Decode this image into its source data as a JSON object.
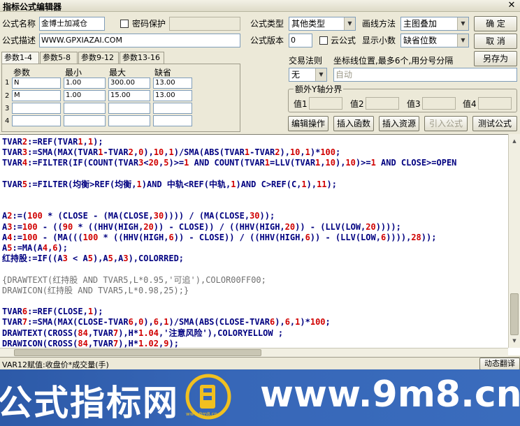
{
  "window": {
    "title": "指标公式编辑器",
    "close_glyph": "✕"
  },
  "form": {
    "name_label": "公式名称",
    "name_value": "金博士加减仓",
    "password_label": "密码保护",
    "password_checked": false,
    "type_label": "公式类型",
    "type_value": "其他类型",
    "draw_label": "画线方法",
    "draw_value": "主图叠加",
    "desc_label": "公式描述",
    "desc_value": "WWW.GPXIAZAI.COM",
    "version_label": "公式版本",
    "version_value": "0",
    "cloud_label": "云公式",
    "cloud_checked": false,
    "decimals_label": "显示小数",
    "decimals_value": "缺省位数",
    "trade_rule_label": "交易法则",
    "trade_rule_value": "无",
    "coord_label": "坐标线位置,最多6个,用分号分隔",
    "coord_placeholder": "自动",
    "extra_axis_label": "额外Y轴分界",
    "value_labels": [
      "值1",
      "值2",
      "值3",
      "值4"
    ]
  },
  "buttons": {
    "confirm": "确  定",
    "cancel": "取  消",
    "save_as": "另存为",
    "edit_ops": "编辑操作",
    "insert_func": "插入函数",
    "insert_resource": "插入资源",
    "import_formula": "引入公式",
    "test_formula": "测试公式",
    "dynamic_translate": "动态翻译"
  },
  "tabs": [
    "参数1-4",
    "参数5-8",
    "参数9-12",
    "参数13-16"
  ],
  "params": {
    "headers": [
      "参数",
      "最小",
      "最大",
      "缺省"
    ],
    "rows": [
      {
        "num": "1",
        "name": "N",
        "min": "1.00",
        "max": "300.00",
        "default": "13.00"
      },
      {
        "num": "2",
        "name": "M",
        "min": "1.00",
        "max": "15.00",
        "default": "13.00"
      },
      {
        "num": "3",
        "name": "",
        "min": "",
        "max": "",
        "default": ""
      },
      {
        "num": "4",
        "name": "",
        "min": "",
        "max": "",
        "default": ""
      }
    ]
  },
  "code": [
    {
      "text": "TVAR2:=REF(TVAR1,1);",
      "style": "normal"
    },
    {
      "text": "TVAR3:=SMA(MAX(TVAR1-TVAR2,0),10,1)/SMA(ABS(TVAR1-TVAR2),10,1)*100;",
      "style": "normal"
    },
    {
      "text": "TVAR4:=FILTER(IF(COUNT(TVAR3<20,5)>=1 AND COUNT(TVAR1=LLV(TVAR1,10),10)>=1 AND CLOSE>=OPEN",
      "style": "normal"
    },
    {
      "text": "",
      "style": "normal"
    },
    {
      "text": "TVAR5:=FILTER(均衡>REF(均衡,1)AND 中轨<REF(中轨,1)AND C>REF(C,1),11);",
      "style": "normal"
    },
    {
      "text": "",
      "style": "normal"
    },
    {
      "text": "",
      "style": "normal"
    },
    {
      "text": "A2:=(100 * (CLOSE - (MA(CLOSE,30)))) / (MA(CLOSE,30));",
      "style": "normal"
    },
    {
      "text": "A3:=100 - ((90 * ((HHV(HIGH,20)) - CLOSE)) / ((HHV(HIGH,20)) - (LLV(LOW,20))));",
      "style": "normal"
    },
    {
      "text": "A4:=100 - (MA(((100 * ((HHV(HIGH,6)) - CLOSE)) / ((HHV(HIGH,6)) - (LLV(LOW,6)))),28));",
      "style": "normal"
    },
    {
      "text": "A5:=MA(A4,6);",
      "style": "normal"
    },
    {
      "text": "红持股:=IF((A3 < A5),A5,A3),COLORRED;",
      "style": "normal"
    },
    {
      "text": "",
      "style": "normal"
    },
    {
      "text": "{DRAWTEXT(红持股 AND TVAR5,L*0.95,'可追'),COLOR00FF00;",
      "style": "comment"
    },
    {
      "text": "DRAWICON(红持股 AND TVAR5,L*0.98,25);}",
      "style": "comment"
    },
    {
      "text": "",
      "style": "normal"
    },
    {
      "text": "TVAR6:=REF(CLOSE,1);",
      "style": "normal"
    },
    {
      "text": "TVAR7:=SMA(MAX(CLOSE-TVAR6,0),6,1)/SMA(ABS(CLOSE-TVAR6),6,1)*100;",
      "style": "normal"
    },
    {
      "text": "DRAWTEXT(CROSS(84,TVAR7),H*1.04,'注意风险'),COLORYELLOW ;",
      "style": "normal"
    },
    {
      "text": "DRAWICON(CROSS(84,TVAR7),H*1.02,9);",
      "style": "normal"
    }
  ],
  "status": {
    "text": "VAR12赋值:收盘价*成交量(手)"
  },
  "banner": {
    "left_text": "公式指标网",
    "right_text": "www.9m8.cn",
    "logo_text": "www.9m8.cn"
  },
  "colors": {
    "keyword": "#000080",
    "number": "#d00000",
    "comment": "#707070",
    "banner_bg": "#3767b8"
  }
}
